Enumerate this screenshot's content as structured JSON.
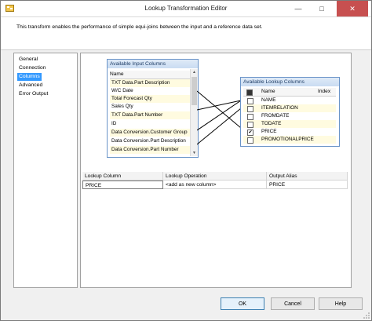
{
  "window": {
    "title": "Lookup Transformation Editor",
    "minimize_glyph": "—",
    "maximize_glyph": "□",
    "close_glyph": "✕"
  },
  "description": "This transform enables the performance of simple equi-joins between the input and a reference data set.",
  "nav": {
    "items": [
      "General",
      "Connection",
      "Columns",
      "Advanced",
      "Error Output"
    ],
    "selected": "Columns"
  },
  "input_columns": {
    "title": "Available Input Columns",
    "header": "Name",
    "rows": [
      "TXT Data.Part Description",
      "W/C Date",
      "Total Forecast Qty",
      "Sales Qty",
      "TXT Data.Part Number",
      "ID",
      "Data Conversion.Customer Group",
      "Data Conversion.Part Description",
      "Data Conversion.Part Number"
    ]
  },
  "lookup_columns": {
    "title": "Available Lookup Columns",
    "header_name": "Name",
    "header_index": "Index",
    "rows": [
      {
        "name": "NAME",
        "checked": false
      },
      {
        "name": "ITEMRELATION",
        "checked": false
      },
      {
        "name": "FROMDATE",
        "checked": false
      },
      {
        "name": "TODATE",
        "checked": false
      },
      {
        "name": "PRICE",
        "checked": true
      },
      {
        "name": "PROMOTIONALPRICE",
        "checked": false
      }
    ]
  },
  "grid": {
    "headers": [
      "Lookup Column",
      "Lookup Operation",
      "Output Alias"
    ],
    "rows": [
      [
        "PRICE",
        "<add as new column>",
        "PRICE"
      ]
    ]
  },
  "buttons": {
    "ok": "OK",
    "cancel": "Cancel",
    "help": "Help"
  },
  "colors": {
    "selection": "#3399ff",
    "close_button": "#c75050",
    "panel_border": "#6a94c8"
  }
}
